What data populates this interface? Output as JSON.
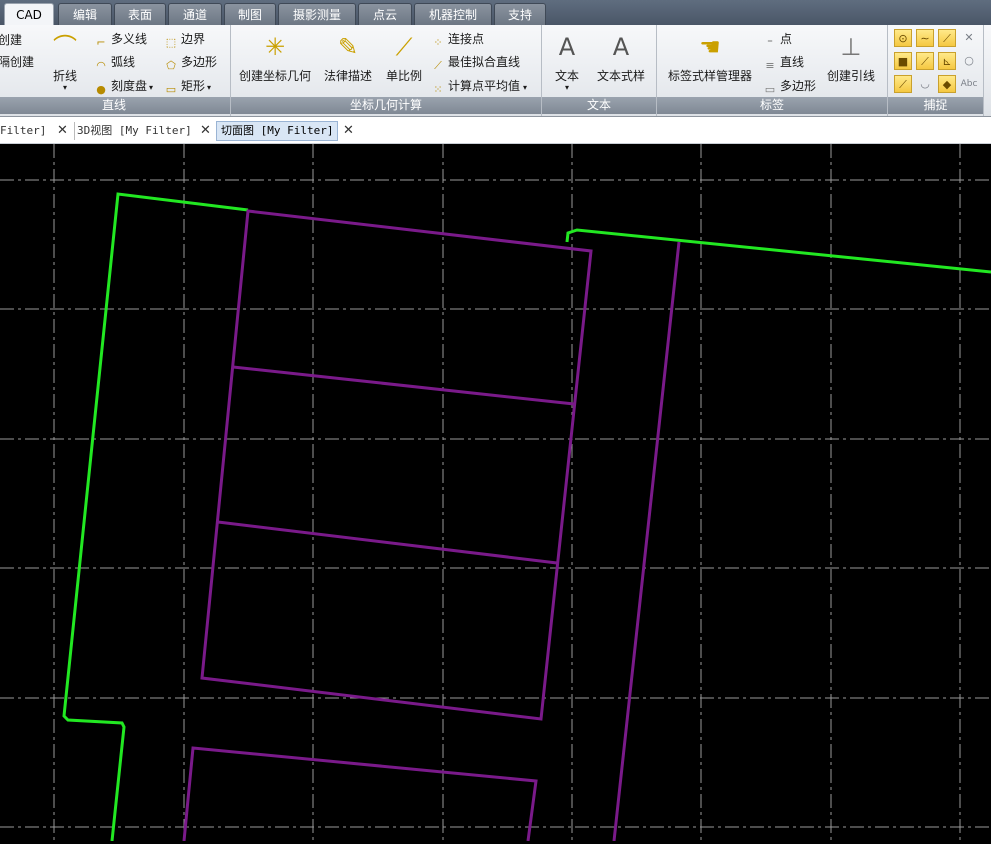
{
  "ribbon_tabs": [
    "CAD",
    "编辑",
    "表面",
    "通道",
    "制图",
    "摄影测量",
    "点云",
    "机器控制",
    "支持"
  ],
  "groups": {
    "line": {
      "title": "直线",
      "partial_left": [
        "创建",
        "隔创建"
      ],
      "polyline": "折线",
      "multiline": "多义线",
      "arc": "弧线",
      "dial": "刻度盘",
      "boundary": "边界",
      "polygon": "多边形",
      "rectangle": "矩形"
    },
    "coord": {
      "title": "坐标几何计算",
      "create_cogo": "创建坐标几何",
      "legal_desc": "法律描述",
      "scale": "单比例",
      "connect_points": "连接点",
      "best_fit": "最佳拟合直线",
      "avg": "计算点平均值"
    },
    "text": {
      "title": "文本",
      "text": "文本",
      "text_style": "文本式样"
    },
    "label": {
      "title": "标签",
      "style_mgr": "标签式样管理器",
      "point": "点",
      "line": "直线",
      "polygon": "多边形",
      "leader": "创建引线"
    },
    "snap": {
      "title": "捕捉",
      "abc": "Abc"
    }
  },
  "doc_tabs": [
    {
      "label": "Filter]",
      "active": false
    },
    {
      "label": "3D视图 [My Filter]",
      "active": false
    },
    {
      "label": "切面图 [My Filter]",
      "active": true
    }
  ],
  "colors": {
    "green_line": "#22e822",
    "purple_line": "#7a1a8a",
    "grid": "#9a9a9a",
    "background": "#000000"
  }
}
